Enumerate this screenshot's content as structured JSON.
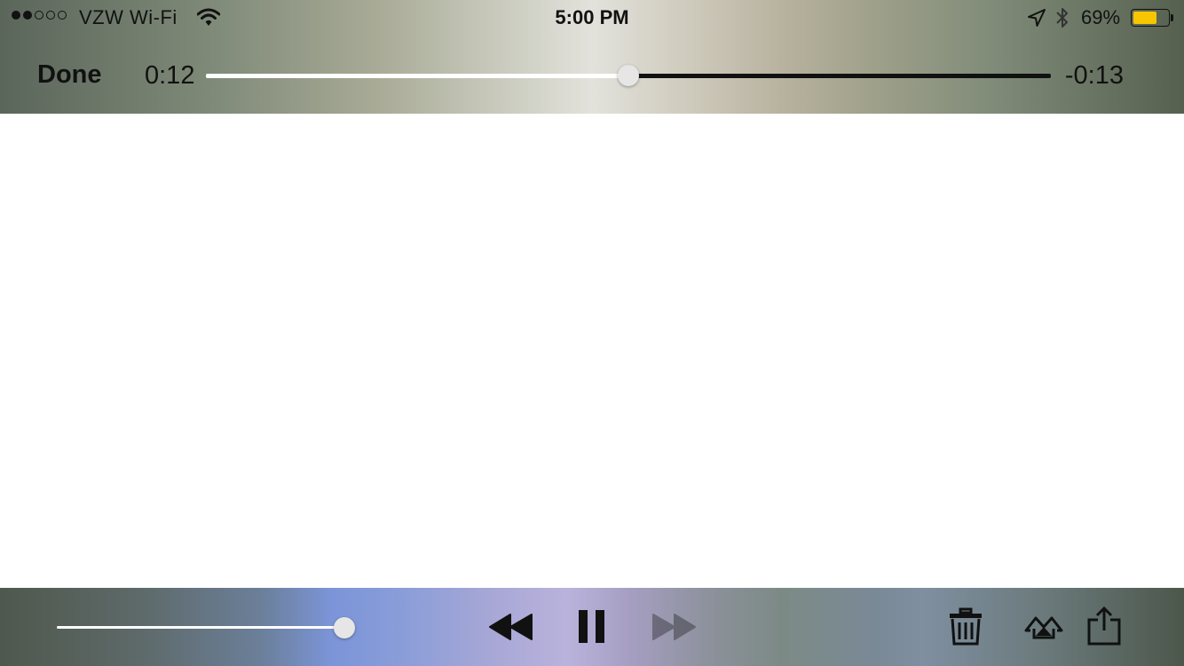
{
  "status_bar": {
    "signal_dots": [
      "filled",
      "filled",
      "empty",
      "empty",
      "empty"
    ],
    "carrier": "VZW Wi-Fi",
    "time": "5:00 PM",
    "battery_percent": "69%",
    "battery_level": 0.69,
    "battery_color": "#f7c600",
    "icons": [
      "wifi-icon",
      "location-icon",
      "bluetooth-icon",
      "battery-icon"
    ]
  },
  "player": {
    "done_label": "Done",
    "elapsed": "0:12",
    "remaining": "-0:13",
    "progress": 0.5,
    "volume": 1.0
  },
  "controls": {
    "icons": [
      "rewind-icon",
      "pause-icon",
      "fast-forward-icon",
      "trash-icon",
      "airplay-icon",
      "share-icon"
    ],
    "fast_forward_enabled": false
  }
}
